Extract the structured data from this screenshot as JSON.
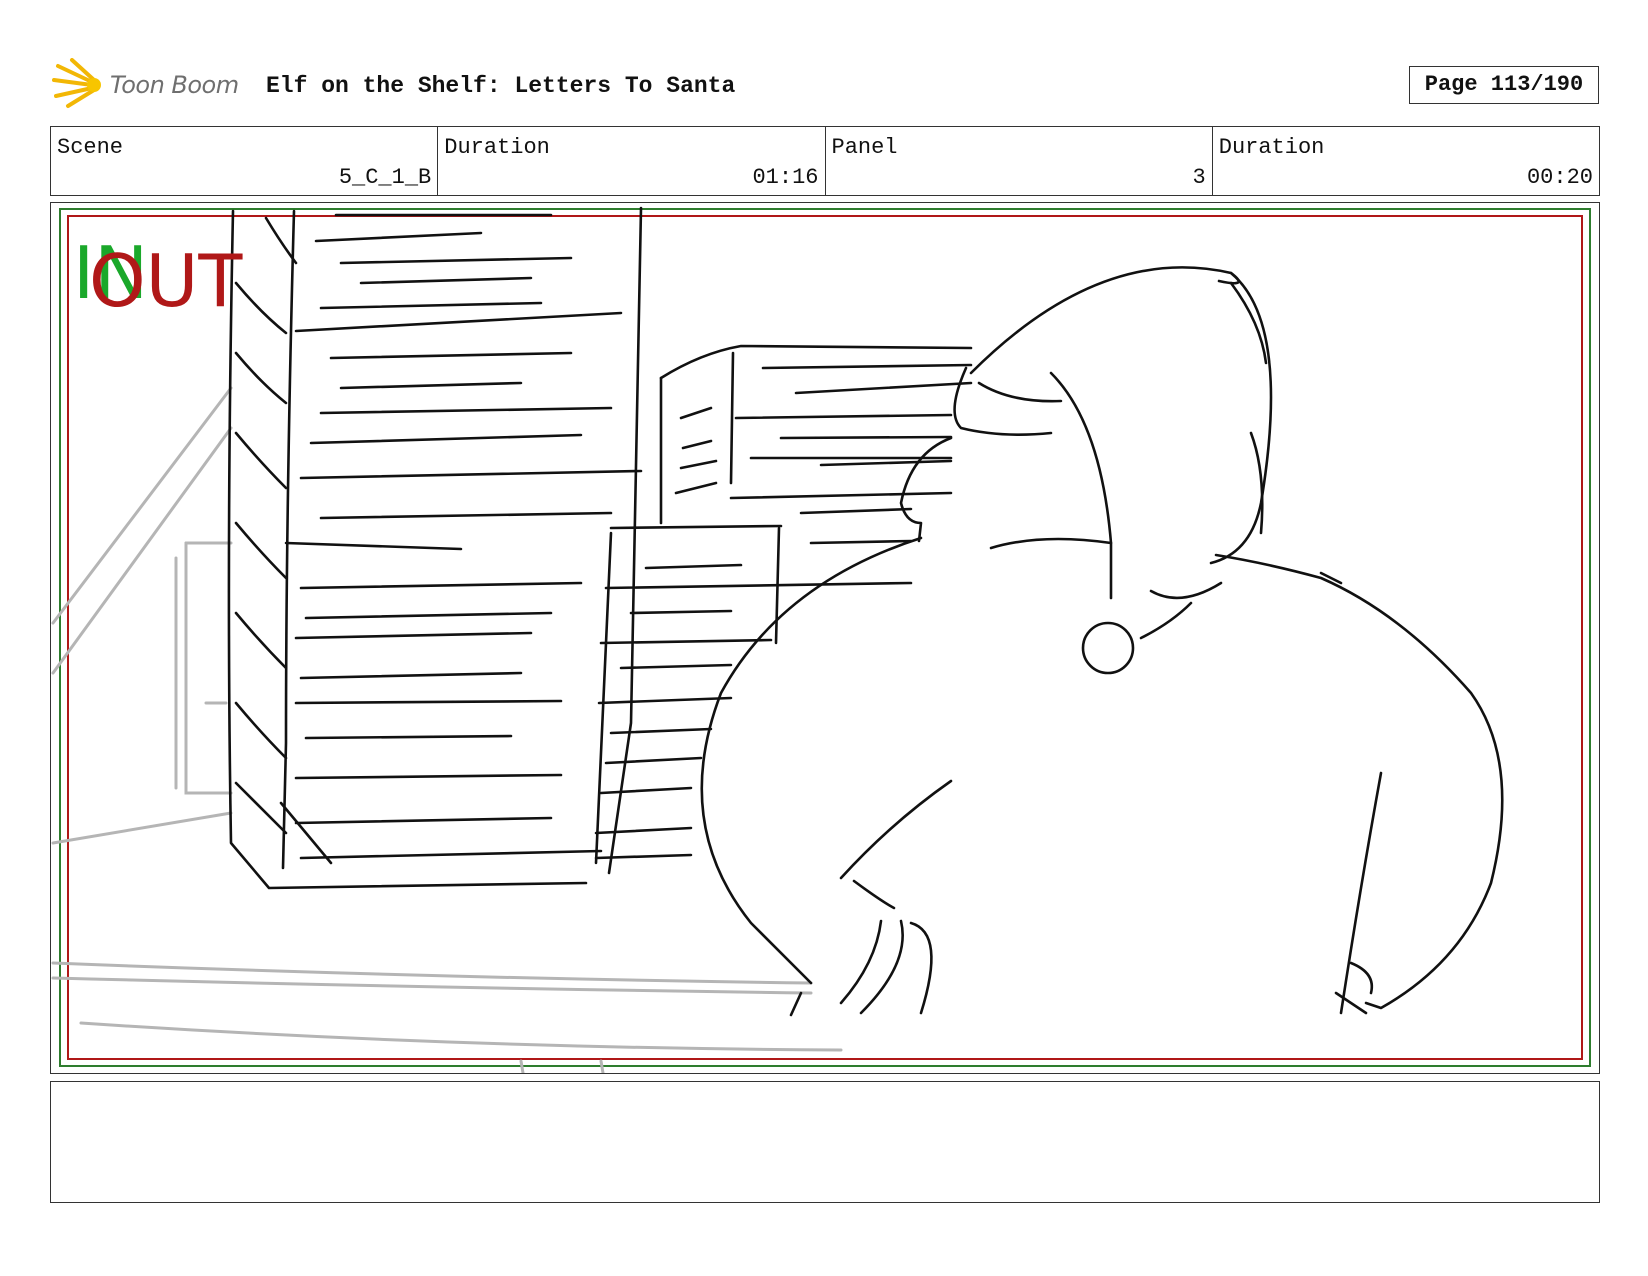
{
  "header": {
    "logo_text": "Toon Boom",
    "project_title": "Elf on the Shelf: Letters To Santa",
    "page_label": "Page 113/190"
  },
  "info": {
    "scene_label": "Scene",
    "scene_value": "5_C_1_B",
    "scene_duration_label": "Duration",
    "scene_duration_value": "01:16",
    "panel_label": "Panel",
    "panel_value": "3",
    "panel_duration_label": "Duration",
    "panel_duration_value": "00:20"
  },
  "panel_frame": {
    "in_label": "IN",
    "out_label": "OUT",
    "in_color": "#1aa82a",
    "out_color": "#b01818"
  },
  "notes": {
    "text": ""
  }
}
